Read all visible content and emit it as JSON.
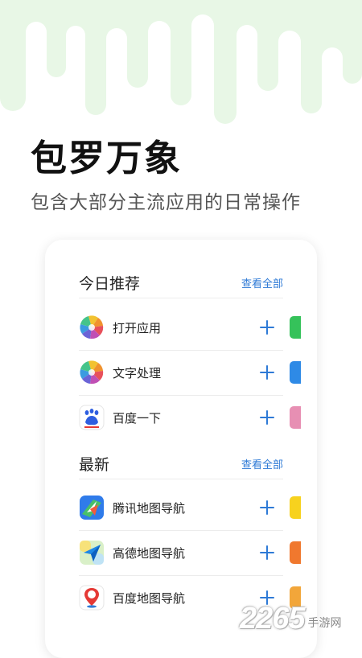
{
  "hero": {
    "title": "包罗万象",
    "subtitle": "包含大部分主流应用的日常操作"
  },
  "colors": {
    "accent": "#2e7ad6",
    "drip": "#e8f7e6"
  },
  "sections": [
    {
      "title": "今日推荐",
      "link": "查看全部",
      "items": [
        {
          "name": "打开应用",
          "icon": "pinwheel-icon"
        },
        {
          "name": "文字处理",
          "icon": "pinwheel-icon"
        },
        {
          "name": "百度一下",
          "icon": "baidu-paw-icon"
        }
      ]
    },
    {
      "title": "最新",
      "link": "查看全部",
      "items": [
        {
          "name": "腾讯地图导航",
          "icon": "tencent-map-icon"
        },
        {
          "name": "高德地图导航",
          "icon": "amap-icon"
        },
        {
          "name": "百度地图导航",
          "icon": "baidu-map-icon"
        }
      ]
    }
  ],
  "watermark": {
    "number": "2265",
    "suffix": "手游网"
  }
}
